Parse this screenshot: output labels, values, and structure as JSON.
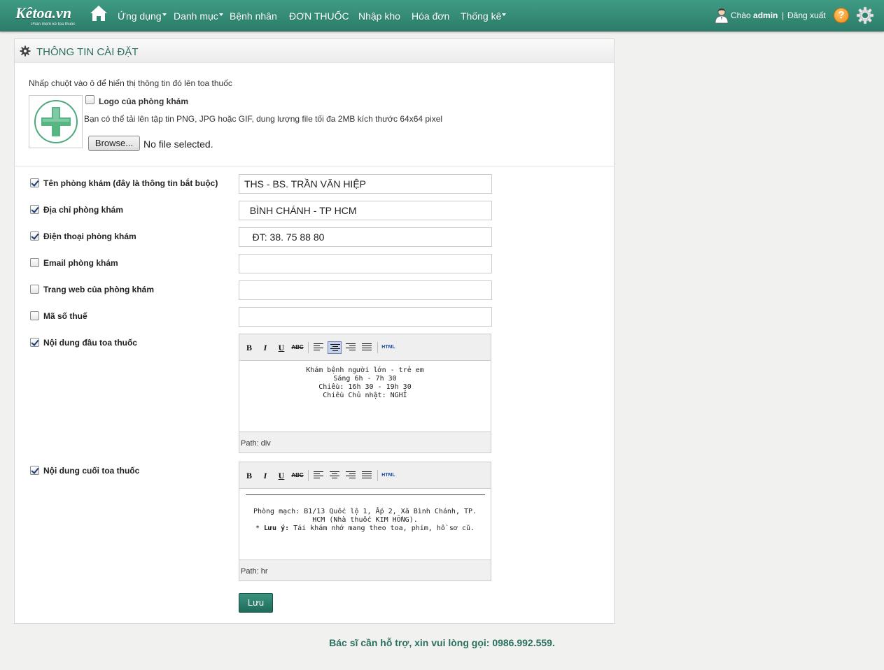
{
  "nav": {
    "brand": "Kêtoa.vn",
    "brand_sub": "Phần mềm kê toa thuốc",
    "items": [
      {
        "label": "Ứng dụng",
        "dropdown": true
      },
      {
        "label": "Danh mục",
        "dropdown": true
      },
      {
        "label": "Bệnh nhân",
        "dropdown": false
      },
      {
        "label": "ĐƠN THUỐC",
        "dropdown": false
      },
      {
        "label": "Nhập kho",
        "dropdown": false
      },
      {
        "label": "Hóa đơn",
        "dropdown": false
      },
      {
        "label": "Thống kê",
        "dropdown": true
      }
    ],
    "greet_prefix": "Chào",
    "username": "admin",
    "separator": "|",
    "logout": "Đăng xuất",
    "help_symbol": "?",
    "colors": {
      "bar": "#2f8470",
      "accent": "#f08a12"
    }
  },
  "panel": {
    "title": "THÔNG TIN CÀI ĐẶT",
    "hint": "Nhấp chuột vào ô để hiển thị thông tin đó lên toa thuốc",
    "logo": {
      "checked": false,
      "label": "Logo của phòng khám",
      "note": "Bạn có thể tải lên tập tin PNG, JPG hoặc GIF, dung lượng file tối đa 2MB kích thước 64x64 pixel",
      "browse": "Browse...",
      "file_status": "No file selected."
    },
    "fields": [
      {
        "label": "Tên phòng khám (đây là thông tin bắt buộc)",
        "checked": true,
        "value": "THS - BS. TRẦN VĂN HIỆP"
      },
      {
        "label": "Địa chỉ phòng khám",
        "checked": true,
        "value": "  BÌNH CHÁNH - TP HCM"
      },
      {
        "label": "Điện thoại phòng khám",
        "checked": true,
        "value": "   ĐT: 38. 75 88 80"
      },
      {
        "label": "Email phòng khám",
        "checked": false,
        "value": ""
      },
      {
        "label": "Trang web của phòng khám",
        "checked": false,
        "value": ""
      },
      {
        "label": "Mã số thuế",
        "checked": false,
        "value": ""
      }
    ],
    "header_editor": {
      "label": "Nội dung đầu toa thuốc",
      "checked": true,
      "lines": [
        "Khám bệnh người lớn - trẻ em",
        "Sáng 6h - 7h 30",
        "Chiều: 16h 30 - 19h 30",
        "Chiều Chủ nhật: NGHỈ"
      ],
      "path": "Path: div"
    },
    "footer_editor": {
      "label": "Nội dung cuối toa thuốc",
      "checked": true,
      "line1": "Phòng mạch: B1/13 Quốc lộ 1, Ấp 2, Xã Bình Chánh, TP.",
      "line2": "HCM (Nhà thuốc KIM HỒNG).",
      "line3_prefix": "* ",
      "line3_bold": "Lưu ý:",
      "line3_rest": " Tái khám nhớ mang theo toa, phim, hồ sơ cũ.",
      "path": "Path: hr"
    },
    "toolbar": {
      "bold": "B",
      "italic": "I",
      "underline": "U",
      "strike": "ABC",
      "html": "HTML"
    },
    "save": "Lưu"
  },
  "footer": "Bác sĩ cần hỗ trợ, xin vui lòng gọi: 0986.992.559."
}
